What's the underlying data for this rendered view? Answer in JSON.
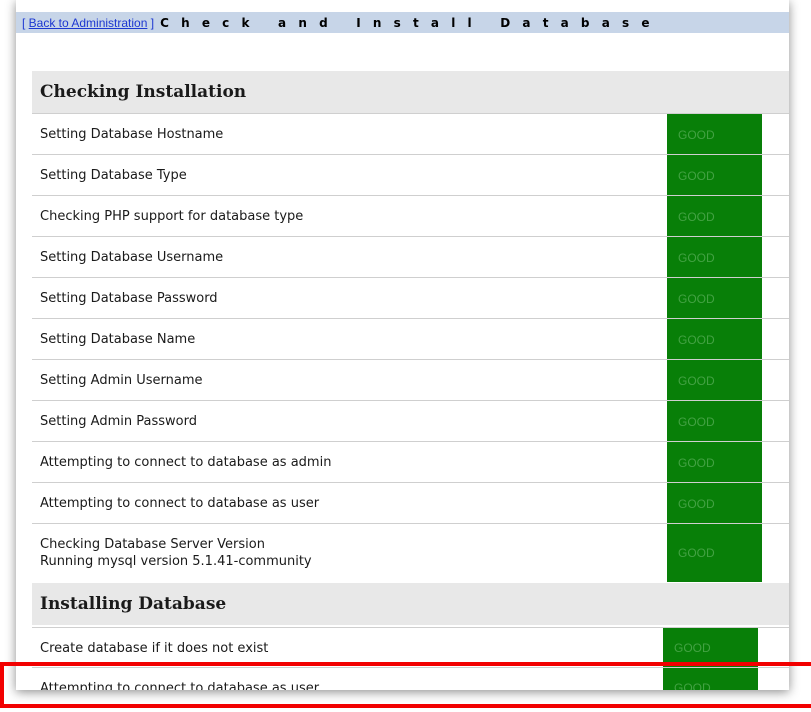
{
  "header": {
    "back_link": "Back to Administration",
    "bracket_open": "[ ",
    "bracket_close": " ]",
    "title": "Check and Install Database"
  },
  "sections": [
    {
      "title": "Checking Installation"
    },
    {
      "title": "Installing Database"
    }
  ],
  "checks": [
    {
      "label": "Setting Database Hostname",
      "status": "GOOD"
    },
    {
      "label": "Setting Database Type",
      "status": "GOOD"
    },
    {
      "label": "Checking PHP support for database type",
      "status": "GOOD"
    },
    {
      "label": "Setting Database Username",
      "status": "GOOD"
    },
    {
      "label": "Setting Database Password",
      "status": "GOOD"
    },
    {
      "label": "Setting Database Name",
      "status": "GOOD"
    },
    {
      "label": "Setting Admin Username",
      "status": "GOOD"
    },
    {
      "label": "Setting Admin Password",
      "status": "GOOD"
    },
    {
      "label": "Attempting to connect to database as admin",
      "status": "GOOD"
    },
    {
      "label": "Attempting to connect to database as user",
      "status": "GOOD"
    },
    {
      "label": "Checking Database Server Version",
      "label_line2": "Running mysql version 5.1.41-community",
      "status": "GOOD"
    }
  ],
  "install_steps": [
    {
      "label": "Create database if it does not exist",
      "status": "GOOD"
    },
    {
      "label": "Attempting to connect to database as user",
      "status": "GOOD"
    }
  ],
  "colors": {
    "status_good_bg": "#087f08",
    "status_good_text": "#43a243",
    "header_bg": "#c7d5e8",
    "section_bg": "#e8e8e8",
    "highlight_border": "#f20000"
  }
}
